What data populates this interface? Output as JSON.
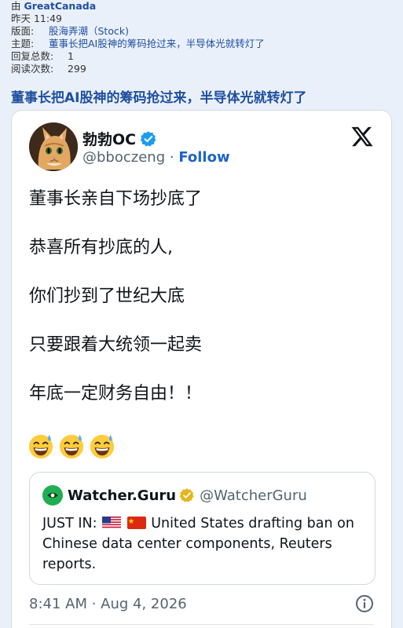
{
  "post_meta": {
    "author_prefix": "由",
    "author": "GreatCanada",
    "time": "昨天 11:49",
    "board_label": "版面:",
    "board": "股海弄潮（Stock)",
    "subject_label": "主题:",
    "subject": "董事长把AI股神的筹码抢过来，半导体光就转灯了",
    "replies_label": "回复总数:",
    "replies": "1",
    "views_label": "阅读次数:",
    "views": "299"
  },
  "topic_title": "董事长把AI股神的筹码抢过来，半导体光就转灯了",
  "tweet": {
    "display_name": "勃勃OC",
    "handle": "@bboczeng",
    "separator": "·",
    "follow_label": "Follow",
    "lines": [
      "董事长亲自下场抄底了",
      "恭喜所有抄底的人,",
      "你们抄到了世纪大底",
      "只要跟着大统领一起卖",
      "年底一定财务自由！！"
    ],
    "emoji_count": 3,
    "emoji_name": "grinning-sweat-emoji",
    "timestamp": "8:41 AM · Aug 4, 2026",
    "colors": {
      "verified": "#1d9bf0",
      "follow": "#1d64c8",
      "text": "#0f1419",
      "muted": "#536471"
    }
  },
  "quote": {
    "name": "Watcher.Guru",
    "handle": "@WatcherGuru",
    "text_prefix": "JUST IN:",
    "flags": [
      "us-flag",
      "china-flag"
    ],
    "text_rest": "United States drafting ban on Chinese data center components, Reuters reports.",
    "colors": {
      "badge": "#e2b719",
      "avatar": "#1fae52"
    }
  }
}
